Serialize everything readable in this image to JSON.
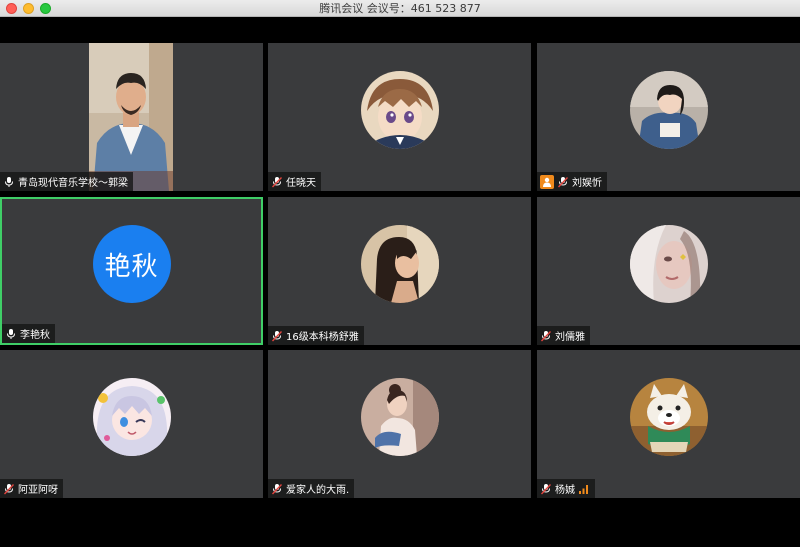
{
  "window": {
    "title": "腾讯会议 会议号：461 523 877"
  },
  "participants": [
    {
      "name": "青岛现代音乐学校～郭梁",
      "mic": "on",
      "display": "video"
    },
    {
      "name": "任晓天",
      "mic": "muted",
      "display": "avatar",
      "avatar_icon": "anime-boy-avatar"
    },
    {
      "name": "刘娱忻",
      "mic": "muted",
      "display": "avatar",
      "avatar_icon": "girl-photo-avatar",
      "host": true
    },
    {
      "name": "李艳秋",
      "mic": "on",
      "display": "text",
      "avatar_text": "艳秋",
      "active_speaker": true
    },
    {
      "name": "16级本科杨舒雅",
      "mic": "muted",
      "display": "avatar",
      "avatar_icon": "woman-profile-avatar"
    },
    {
      "name": "刘儒雅",
      "mic": "muted",
      "display": "avatar",
      "avatar_icon": "woman-faded-avatar"
    },
    {
      "name": "阿亚阿呀",
      "mic": "muted",
      "display": "avatar",
      "avatar_icon": "anime-girl-avatar"
    },
    {
      "name": "爱家人的大雨.",
      "mic": "muted",
      "display": "avatar",
      "avatar_icon": "woman-sitting-avatar"
    },
    {
      "name": "杨娍",
      "mic": "muted",
      "display": "avatar",
      "avatar_icon": "dog-figurine-avatar",
      "signal_indicator": true
    }
  ],
  "colors": {
    "tile_bg": "#3a3b3d",
    "active_border": "#3fce67",
    "text_avatar_bg": "#1a7ff0",
    "host_badge": "#f08a1c",
    "muted_mic": "#e0443e"
  }
}
